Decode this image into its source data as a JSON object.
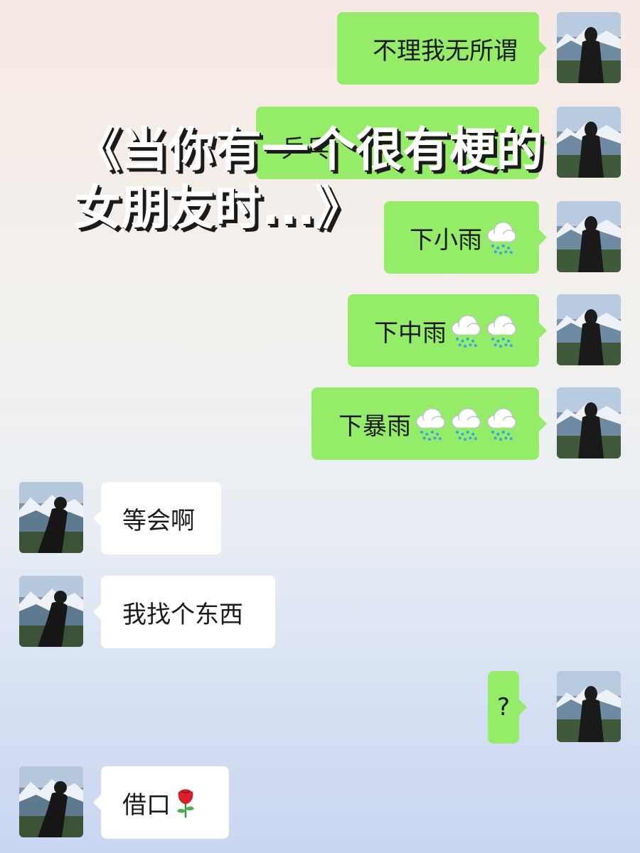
{
  "title_overlay": {
    "line1": "《当你有一个很有梗的",
    "line2": "女朋友时...》"
  },
  "partial_hidden_text": "乒乓",
  "messages": [
    {
      "sender": "me",
      "text": "不理我无所谓",
      "icons": []
    },
    {
      "sender": "me",
      "text": "",
      "icons": []
    },
    {
      "sender": "me",
      "text": "下小雨",
      "icons": [
        "rain-cloud-icon"
      ]
    },
    {
      "sender": "me",
      "text": "下中雨",
      "icons": [
        "rain-cloud-icon",
        "rain-cloud-icon"
      ]
    },
    {
      "sender": "me",
      "text": "下暴雨",
      "icons": [
        "rain-cloud-icon",
        "rain-cloud-icon",
        "rain-cloud-icon"
      ]
    },
    {
      "sender": "other",
      "text": "等会啊",
      "icons": []
    },
    {
      "sender": "other",
      "text": "我找个东西",
      "icons": []
    },
    {
      "sender": "me",
      "text": "?",
      "icons": []
    },
    {
      "sender": "other",
      "text": "借口",
      "icons": [
        "rose-icon"
      ]
    }
  ],
  "colors": {
    "my_bubble": "#95ec69",
    "other_bubble": "#ffffff",
    "title_text": "#ffffff",
    "title_shadow": "#1b1b1b"
  }
}
